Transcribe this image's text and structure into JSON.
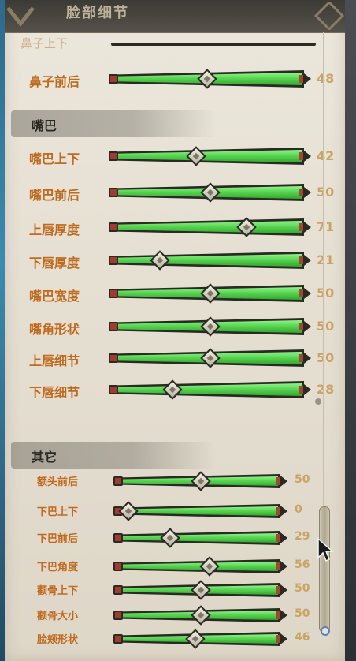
{
  "window": {
    "title": "脸部细节"
  },
  "partial_row": {
    "label": "鼻子上下"
  },
  "sections": [
    {
      "title": "",
      "rows": [
        {
          "label": "鼻子前后",
          "value": 48
        }
      ]
    },
    {
      "title": "嘴巴",
      "rows": [
        {
          "label": "嘴巴上下",
          "value": 42
        },
        {
          "label": "嘴巴前后",
          "value": 50
        },
        {
          "label": "上唇厚度",
          "value": 71
        },
        {
          "label": "下唇厚度",
          "value": 21
        },
        {
          "label": "嘴巴宽度",
          "value": 50
        },
        {
          "label": "嘴角形状",
          "value": 50
        },
        {
          "label": "上唇细节",
          "value": 50
        },
        {
          "label": "下唇细节",
          "value": 28
        }
      ]
    },
    {
      "title": "其它",
      "rows": [
        {
          "label": "额头前后",
          "value": 50
        },
        {
          "label": "下巴上下",
          "value": 0
        },
        {
          "label": "下巴前后",
          "value": 29
        },
        {
          "label": "下巴角度",
          "value": 56
        },
        {
          "label": "颧骨上下",
          "value": 50
        },
        {
          "label": "颧骨大小",
          "value": 50
        },
        {
          "label": "脸颊形状",
          "value": 46
        }
      ]
    }
  ],
  "colors": {
    "label": "#c06a1e",
    "value": "#c9a466",
    "track_fill": "#53d04d",
    "panel_bg": "#e6e0d3"
  },
  "scroll": {
    "position": 0.78
  }
}
